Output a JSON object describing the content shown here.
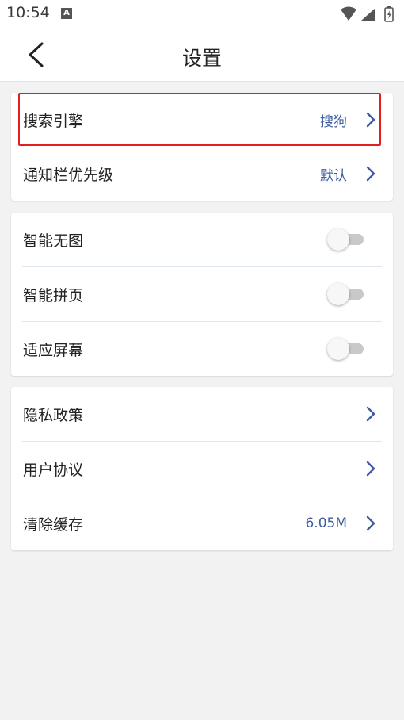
{
  "status_bar": {
    "time": "10:54",
    "notification_icon": "A"
  },
  "header": {
    "title": "设置"
  },
  "card1": {
    "rows": [
      {
        "label": "搜索引擎",
        "value": "搜狗"
      },
      {
        "label": "通知栏优先级",
        "value": "默认"
      }
    ]
  },
  "card2": {
    "rows": [
      {
        "label": "智能无图",
        "toggle_on": false
      },
      {
        "label": "智能拼页",
        "toggle_on": false
      },
      {
        "label": "适应屏幕",
        "toggle_on": false
      }
    ]
  },
  "card3": {
    "rows": [
      {
        "label": "隐私政策"
      },
      {
        "label": "用户协议"
      },
      {
        "label": "清除缓存",
        "value": "6.05M"
      }
    ]
  },
  "colors": {
    "accent": "#3e5ca0",
    "highlight": "#e02020"
  }
}
